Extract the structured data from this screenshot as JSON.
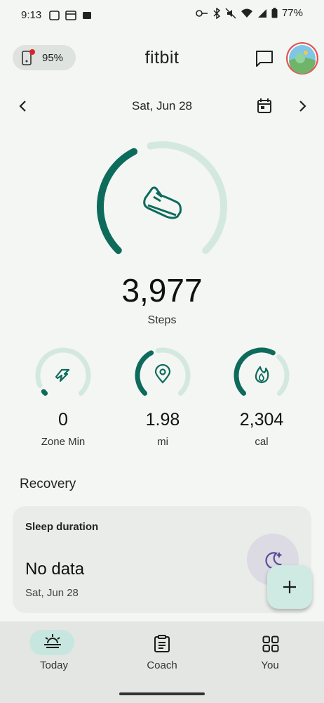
{
  "status_bar": {
    "time": "9:13",
    "battery": "77%"
  },
  "header": {
    "device_battery": "95%",
    "title": "fitbit"
  },
  "date_nav": {
    "date": "Sat, Jun 28"
  },
  "steps": {
    "value": "3,977",
    "label": "Steps",
    "progress": 0.4
  },
  "stats": [
    {
      "value": "0",
      "label": "Zone Min",
      "icon": "zone-minutes-icon",
      "progress": 0.02
    },
    {
      "value": "1.98",
      "label": "mi",
      "icon": "location-pin-icon",
      "progress": 0.4
    },
    {
      "value": "2,304",
      "label": "cal",
      "icon": "flame-icon",
      "progress": 0.6
    }
  ],
  "recovery": {
    "heading": "Recovery",
    "card_title": "Sleep duration",
    "card_value": "No data",
    "card_date": "Sat, Jun 28"
  },
  "bottom_nav": [
    {
      "label": "Today",
      "icon": "sun-horizon-icon",
      "active": true
    },
    {
      "label": "Coach",
      "icon": "clipboard-icon",
      "active": false
    },
    {
      "label": "You",
      "icon": "grid-icon",
      "active": false
    }
  ],
  "colors": {
    "accent": "#0d6b5c",
    "track": "#d3e8e1",
    "background": "#f4f6f3"
  }
}
